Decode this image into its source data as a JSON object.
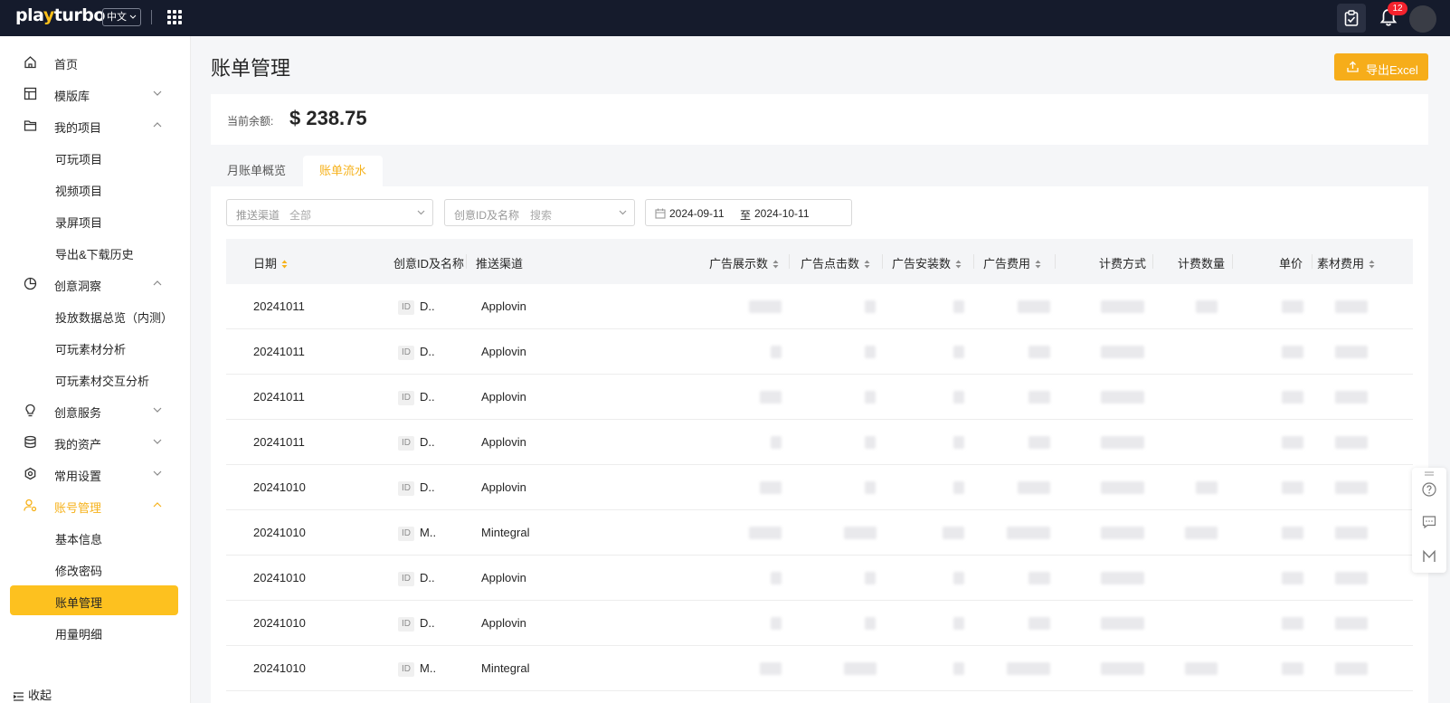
{
  "topbar": {
    "logo_part1": "pla",
    "logo_y": "y",
    "logo_part2": "turbo",
    "language": "中文",
    "notification_count": "12"
  },
  "sidebar": {
    "items": [
      {
        "label": "首页"
      },
      {
        "label": "模版库"
      },
      {
        "label": "我的项目"
      },
      {
        "label": "可玩项目"
      },
      {
        "label": "视频项目"
      },
      {
        "label": "录屏项目"
      },
      {
        "label": "导出&下载历史"
      },
      {
        "label": "创意洞察"
      },
      {
        "label": "投放数据总览（内测）"
      },
      {
        "label": "可玩素材分析"
      },
      {
        "label": "可玩素材交互分析"
      },
      {
        "label": "创意服务"
      },
      {
        "label": "我的资产"
      },
      {
        "label": "常用设置"
      },
      {
        "label": "账号管理"
      },
      {
        "label": "基本信息"
      },
      {
        "label": "修改密码"
      },
      {
        "label": "账单管理"
      },
      {
        "label": "用量明细"
      }
    ],
    "collapse_label": "收起"
  },
  "main": {
    "title": "账单管理",
    "export_label": "导出Excel",
    "balance_label": "当前余额:",
    "balance_value": "$ 238.75",
    "tabs": [
      {
        "label": "月账单概览"
      },
      {
        "label": "账单流水"
      }
    ],
    "filters": {
      "channel_label": "推送渠道",
      "channel_value": "全部",
      "creative_label": "创意ID及名称",
      "creative_placeholder": "搜索",
      "date_start": "2024-09-11",
      "date_sep": "至",
      "date_end": "2024-10-11"
    }
  },
  "table": {
    "columns": [
      "日期",
      "创意ID及名称",
      "推送渠道",
      "广告展示数",
      "广告点击数",
      "广告安装数",
      "广告费用",
      "计费方式",
      "计费数量",
      "单价",
      "素材费用"
    ],
    "id_tag": "ID",
    "rows": [
      {
        "date": "20241011",
        "name": "D..",
        "channel": "Applovin"
      },
      {
        "date": "20241011",
        "name": "D..",
        "channel": "Applovin"
      },
      {
        "date": "20241011",
        "name": "D..",
        "channel": "Applovin"
      },
      {
        "date": "20241011",
        "name": "D..",
        "channel": "Applovin"
      },
      {
        "date": "20241010",
        "name": "D..",
        "channel": "Applovin"
      },
      {
        "date": "20241010",
        "name": "M..",
        "channel": "Mintegral"
      },
      {
        "date": "20241010",
        "name": "D..",
        "channel": "Applovin"
      },
      {
        "date": "20241010",
        "name": "D..",
        "channel": "Applovin"
      },
      {
        "date": "20241010",
        "name": "M..",
        "channel": "Mintegral"
      }
    ]
  },
  "colors": {
    "accent": "#fdc11f",
    "accent_text": "#f6b21c",
    "topbar": "#151b2c",
    "badge": "#f5222d"
  }
}
